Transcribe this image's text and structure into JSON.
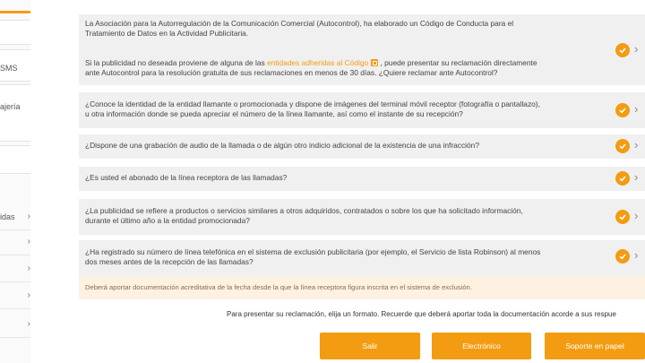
{
  "sidebar": {
    "partial_items": [
      "SMS",
      "ajería",
      "idas"
    ],
    "row_count": 5
  },
  "cards": [
    {
      "text_1": "La Asociación para la Autorregulación de la Comunicación Comercial (Autocontrol), ha elaborado un Código de Conducta para el",
      "text_2": "Tratamiento de Datos en la Actividad Publicitaria.",
      "text_3_pre": "Si la publicidad no deseada proviene de alguna de las ",
      "text_3_link": "entidades adheridas al Código",
      "text_3_post": " , puede presentar su reclamación directamente",
      "text_4": "ante Autocontrol para la resolución gratuita de sus reclamaciones en menos de 30 días. ¿Quiere reclamar ante Autocontrol?"
    },
    {
      "text_1": "¿Conoce la identidad de la entidad llamante o promocionada y dispone de imágenes del terminal móvil receptor (fotografía o pantallazo),",
      "text_2": "u otra información donde se pueda apreciar el número de la línea llamante, así como el instante de su recepción?"
    },
    {
      "text_1": "¿Dispone de una grabación de audio de la llamada o de algún otro indicio adicional de la existencia de una infracción?"
    },
    {
      "text_1": "¿Es usted el abonado de la línea receptora de las llamadas?"
    },
    {
      "text_1": "¿La publicidad se refiere a productos o servicios similares a otros adquiridos, contratados o sobre los que ha solicitado información,",
      "text_2": "durante el último año a la entidad promocionada?"
    },
    {
      "text_1": "¿Ha registrado su número de línea telefónica en el sistema de exclusión publicitaria (por ejemplo, el Servicio de lista Robinson) al menos",
      "text_2": "dos meses antes de la recepción de las llamadas?"
    }
  ],
  "note": "Deberá aportar documentación acreditativa de la fecha desde la que la línea receptora figura inscrita en el sistema de exclusión.",
  "instructions": "Para presentar su reclamación, elija un formato. Recuerde que deberá aportar toda la documentación acorde a sus respue",
  "buttons": {
    "exit": "Salir",
    "electronic": "Electrónico",
    "paper": "Soporte en papel"
  },
  "colors": {
    "accent": "#f39c12",
    "card_bg": "#f0f0f0",
    "note_bg": "#fdf1e2"
  },
  "icons": {
    "answer": "check-circle-icon",
    "next": "chevron-right-icon",
    "link": "external-link-icon"
  }
}
